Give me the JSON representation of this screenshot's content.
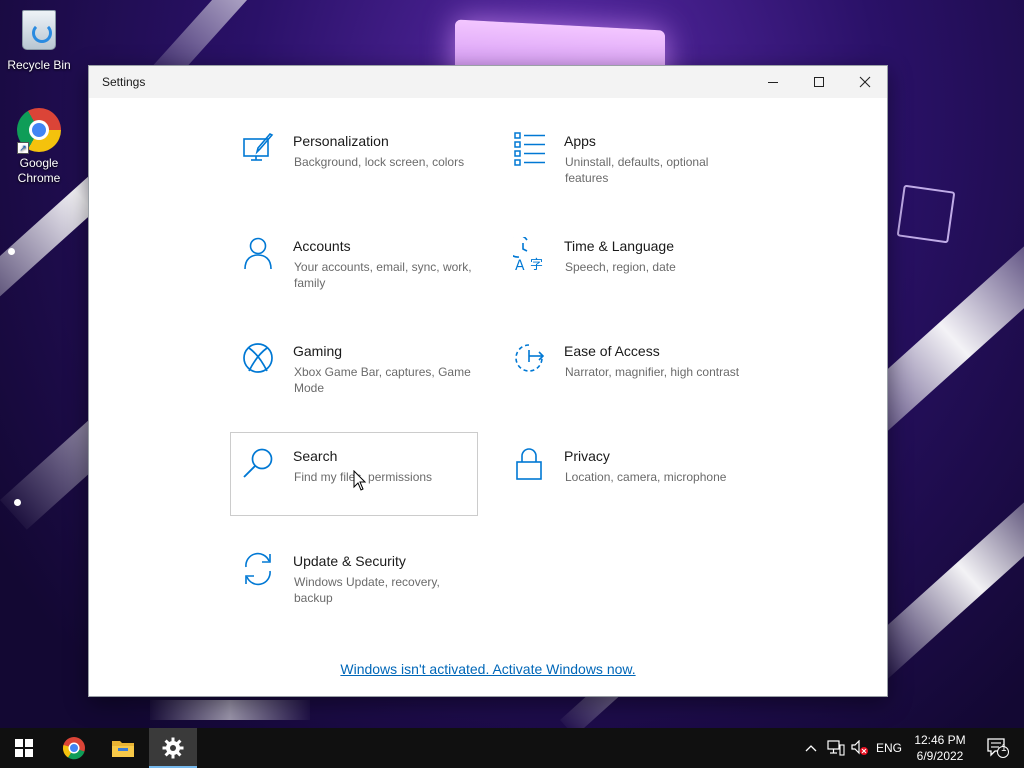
{
  "desktop": {
    "icons": [
      {
        "label": "Recycle Bin",
        "icon": "recycle-bin-icon"
      },
      {
        "label": "Google Chrome",
        "icon": "chrome-icon"
      }
    ]
  },
  "window": {
    "title": "Settings",
    "controls": [
      "minimize-icon",
      "maximize-icon",
      "close-icon"
    ],
    "tiles": [
      {
        "name": "Personalization",
        "desc": "Background, lock screen, colors",
        "icon": "personalization-icon"
      },
      {
        "name": "Apps",
        "desc": "Uninstall, defaults, optional features",
        "icon": "apps-icon"
      },
      {
        "name": "Accounts",
        "desc": "Your accounts, email, sync, work, family",
        "icon": "accounts-icon"
      },
      {
        "name": "Time & Language",
        "desc": "Speech, region, date",
        "icon": "time-language-icon"
      },
      {
        "name": "Gaming",
        "desc": "Xbox Game Bar, captures, Game Mode",
        "icon": "xbox-icon"
      },
      {
        "name": "Ease of Access",
        "desc": "Narrator, magnifier, high contrast",
        "icon": "ease-of-access-icon"
      },
      {
        "name": "Search",
        "desc": "Find my files, permissions",
        "icon": "search-icon"
      },
      {
        "name": "Privacy",
        "desc": "Location, camera, microphone",
        "icon": "lock-icon"
      },
      {
        "name": "Update & Security",
        "desc": "Windows Update, recovery, backup",
        "icon": "update-icon"
      }
    ],
    "activation_link": "Windows isn't activated. Activate Windows now."
  },
  "taskbar": {
    "apps": [
      "start-icon",
      "chrome-icon",
      "file-explorer-icon",
      "settings-gear-icon"
    ],
    "language": "ENG",
    "time": "12:46 PM",
    "date": "6/9/2022",
    "notification_count": "1"
  },
  "colors": {
    "accent": "#0067b8",
    "icon_blue": "#0078d4",
    "taskbar": "#101010",
    "active_indicator": "#76b9ed"
  }
}
